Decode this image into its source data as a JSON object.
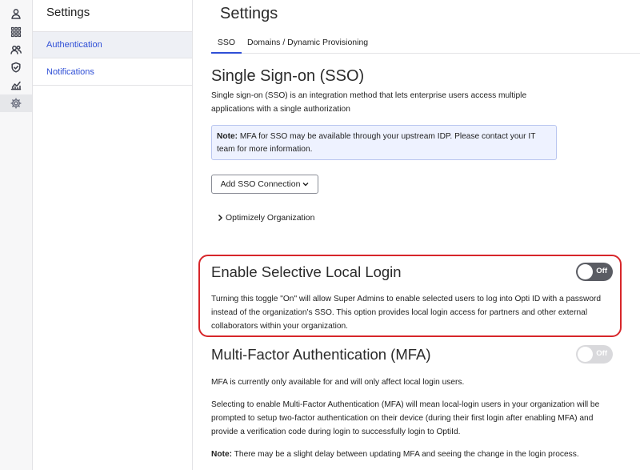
{
  "sidebar": {
    "title": "Settings",
    "items": [
      {
        "label": "Authentication"
      },
      {
        "label": "Notifications"
      }
    ]
  },
  "rail": {
    "icons": [
      "user-icon",
      "grid-icon",
      "users-icon",
      "shield-icon",
      "analytics-icon",
      "gear-icon"
    ]
  },
  "main": {
    "title": "Settings",
    "tabs": [
      {
        "label": "SSO",
        "active": true
      },
      {
        "label": "Domains / Dynamic Provisioning",
        "active": false
      }
    ],
    "sso": {
      "heading": "Single Sign-on (SSO)",
      "description_line1": "Single sign-on (SSO) is an integration method that lets enterprise users access multiple",
      "description_line2": "applications with a single authorization",
      "note_label": "Note:",
      "note_text_line1": " MFA for SSO may be available through your upstream IDP. Please contact your IT",
      "note_text_line2": "team for more information.",
      "add_button": "Add SSO Connection",
      "org_row": "Optimizely Organization"
    },
    "selective_login": {
      "heading": "Enable Selective Local Login",
      "toggle_label": "Off",
      "line1": "Turning this toggle \"On\" will allow Super Admins to enable selected users to log into Opti ID with a password",
      "line2": "instead of the organization's SSO. This option provides local login access for partners and other external",
      "line3": "collaborators within your organization."
    },
    "mfa": {
      "heading": "Multi-Factor Authentication (MFA)",
      "toggle_label": "Off",
      "p1": "MFA is currently only available for and will only affect local login users.",
      "p2_line1": "Selecting to enable Multi-Factor Authentication (MFA) will mean local-login users in your organization will be",
      "p2_line2": "prompted to setup two-factor authentication on their device (during their first login after enabling MFA) and",
      "p2_line3": "provide a verification code during login to successfully login to OptiId.",
      "note_label": "Note:",
      "note_text": " There may be a slight delay between updating MFA and seeing the change in the login process."
    }
  },
  "colors": {
    "accent": "#2f4fd6",
    "highlight": "#d7262a",
    "toggle_off_dark": "#5a5c63",
    "toggle_off_light": "#d9d9dc",
    "note_bg": "#eef2ff"
  }
}
